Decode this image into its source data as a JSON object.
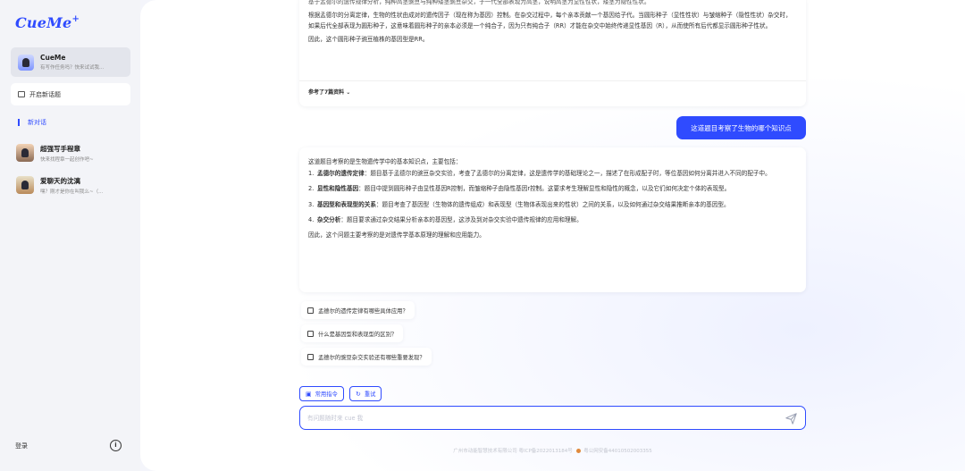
{
  "sidebar": {
    "logo": "CueMe",
    "logo_plus": "+",
    "bot": {
      "name": "CueMe",
      "sub": "有写作任务吗？快来试试我..."
    },
    "new_topic_label": "开启新话题",
    "new_chat_label": "新对话",
    "sessions": [
      {
        "title": "超强写手程章",
        "sub": "快来找程章一起创作吧~"
      },
      {
        "title": "爱聊天的沈漓",
        "sub": "嘿？刚才是你在叫我么~（..."
      }
    ],
    "login_label": "登录",
    "info_icon": "i"
  },
  "conversation": {
    "answer1": {
      "top_cut": "基于孟德尔的遗传规律分析，纯种高茎豌豆与纯种矮茎豌豆杂交，子一代全部表现为高茎，说明高茎为显性性状，矮茎为隐性性状。",
      "p1": "根据孟德尔的分离定律，生物的性状由成对的遗传因子（现在称为基因）控制。在杂交过程中，每个亲本贡献一个基因给子代。当圆形种子（显性性状）与皱缩种子（隐性性状）杂交时，如果后代全部表现为圆形种子，这意味着圆形种子的亲本必须是一个纯合子，因为只有纯合子（RR）才能在杂交中始终传递显性基因（R），从而使所有后代都显示圆形种子性状。",
      "p2": "因此，这个圆形种子豌豆植株的基因型是RR。",
      "ref": "参考了7篇资料"
    },
    "user_question": "这道题目考察了生物的哪个知识点",
    "answer2": {
      "intro": "这道题目考察的是生物遗传学中的基本知识点，主要包括：",
      "items": [
        {
          "n": "1.",
          "head": "孟德尔的遗传定律",
          "body": "：题目基于孟德尔的豌豆杂交实验，考查了孟德尔的分离定律，这是遗传学的基础理论之一，描述了在形成配子时，等位基因如何分离并进入不同的配子中。"
        },
        {
          "n": "2.",
          "head": "显性和隐性基因",
          "body": "：题目中提到圆形种子由显性基因R控制，而皱缩种子由隐性基因r控制。这要求考生理解显性和隐性的概念，以及它们如何决定个体的表现型。"
        },
        {
          "n": "3.",
          "head": "基因型和表现型的关系",
          "body": "：题目考查了基因型（生物体的遗传组成）和表现型（生物体表现出来的性状）之间的关系，以及如何通过杂交结果推断亲本的基因型。"
        },
        {
          "n": "4.",
          "head": "杂交分析",
          "body": "：题目要求通过杂交结果分析亲本的基因型，这涉及到对杂交实验中遗传规律的应用和理解。"
        }
      ],
      "outro": "因此，这个问题主要考察的是对遗传学基本原理的理解和应用能力。"
    },
    "suggestions": [
      "孟德尔的遗传定律有哪些具体应用？",
      "什么是基因型和表现型的区别？",
      "孟德尔的豌豆杂交实验还有哪些重要发现？"
    ]
  },
  "toolbar": {
    "common_cmd": "常用指令",
    "retry": "重试"
  },
  "input": {
    "placeholder": "有问题随时来 cue 我"
  },
  "footer": {
    "company": "广州市动能智慧技术有限公司 粤ICP备2022013184号",
    "police": "粤公网安备44010502003355"
  },
  "colors": {
    "accent": "#2f4bff"
  }
}
